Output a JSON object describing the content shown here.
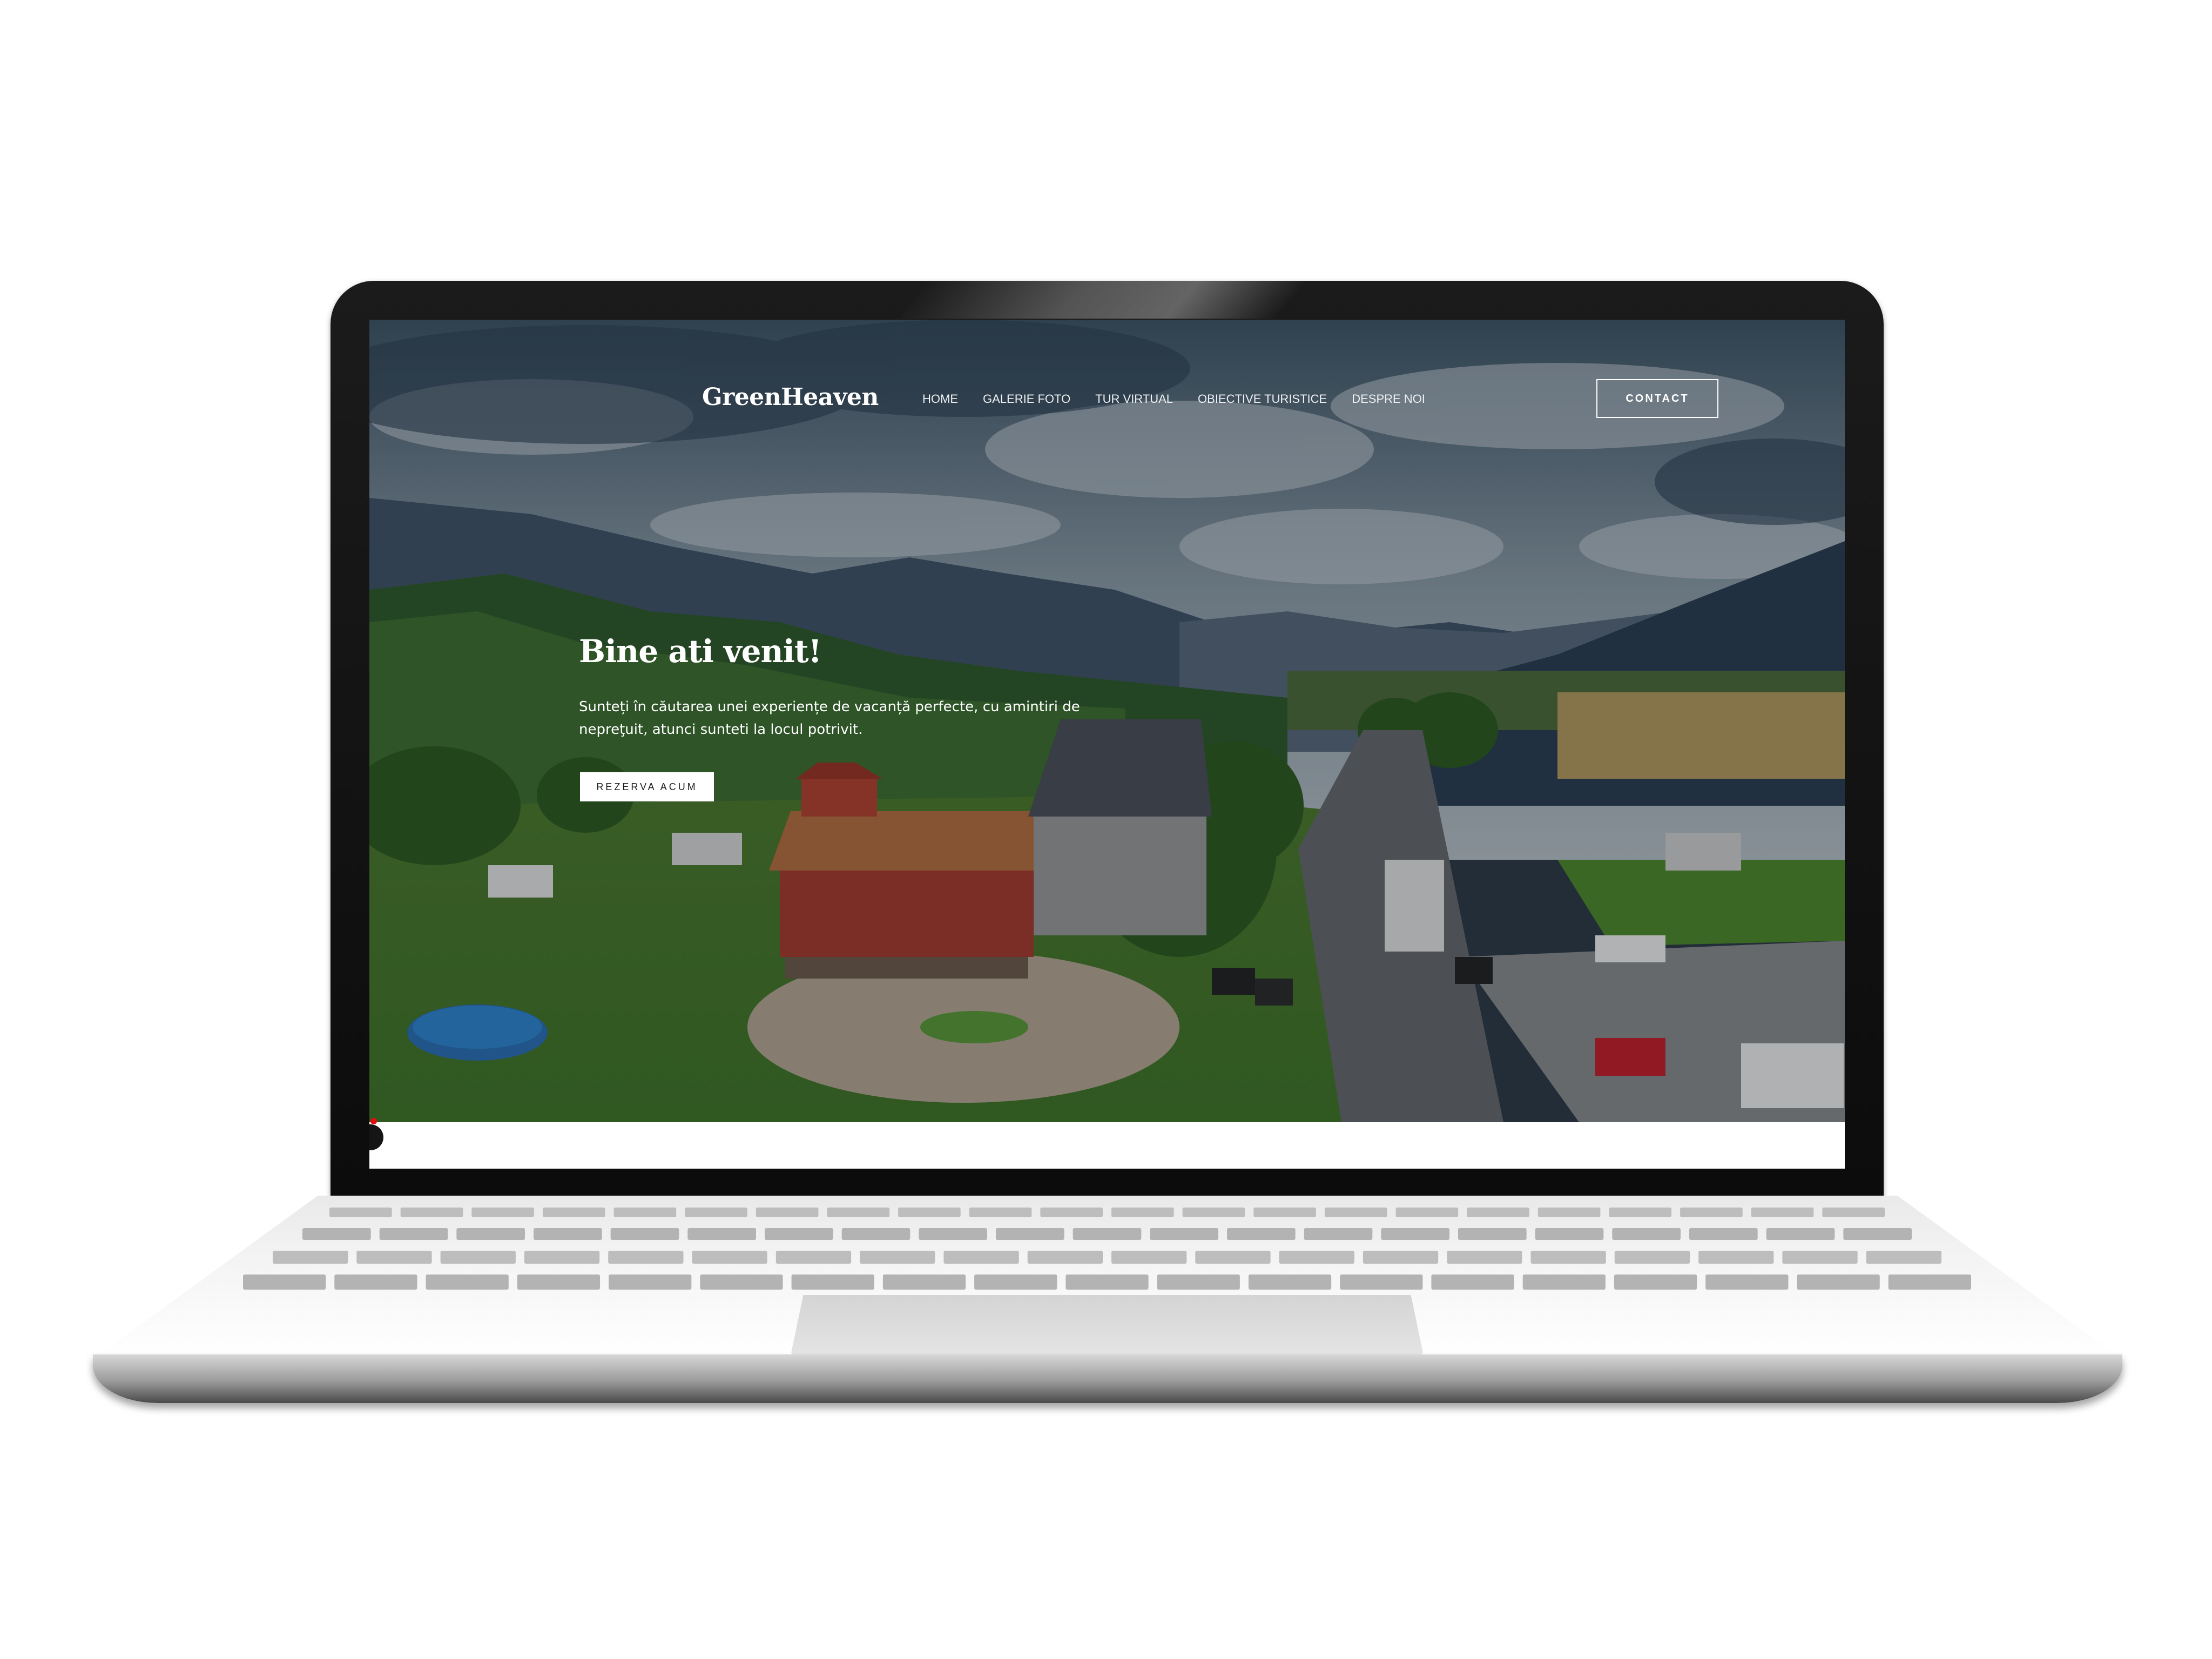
{
  "site": {
    "brand": "GreenHeaven",
    "nav": [
      "HOME",
      "GALERIE FOTO",
      "TUR VIRTUAL",
      "OBIECTIVE TURISTICE",
      "DESPRE NOI"
    ],
    "contact_label": "CONTACT"
  },
  "hero": {
    "title": "Bine ati venit!",
    "text": "Sunteți în căutarea unei experiențe de vacanță perfecte, cu amintiri de nepreţuit, atunci sunteti la locul potrivit.",
    "cta_label": "REZERVA ACUM"
  },
  "colors": {
    "bezel": "#111111",
    "sky": "#5d7282",
    "mountains": "#2b3c4f",
    "grass": "#4f8a2e",
    "road": "#6c6c6c",
    "accent_red": "#e01010"
  }
}
